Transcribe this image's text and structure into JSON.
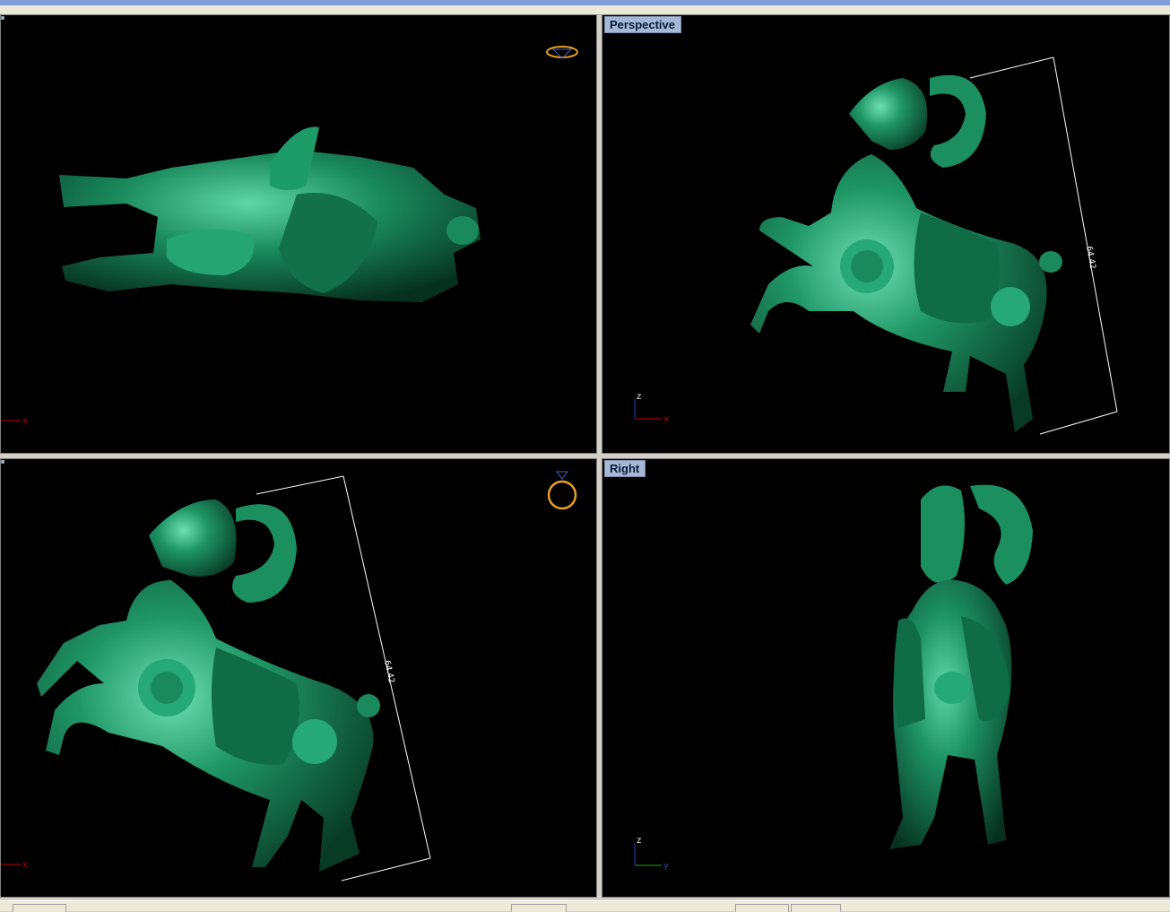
{
  "viewports": {
    "top_left": {
      "title": "",
      "widget_icon": "diamond-icon",
      "axes": {
        "h": "x"
      }
    },
    "top_right": {
      "title": "Perspective",
      "dimension": "64.42",
      "axes": {
        "v": "z",
        "h": "x"
      }
    },
    "bottom_left": {
      "title": "",
      "widget_icon": "ring-icon",
      "dimension": "64.42",
      "axes": {
        "h": "x"
      }
    },
    "bottom_right": {
      "title": "Right",
      "axes": {
        "v": "z",
        "h": "y"
      }
    }
  },
  "colors": {
    "model_green": "#1a8a5e",
    "dimension_line": "#ffffff",
    "axis_x": "#c00000",
    "axis_y": "#20a020",
    "axis_z": "#2040c0",
    "widget_gold": "#e8a020",
    "viewport_bg": "#000000"
  }
}
